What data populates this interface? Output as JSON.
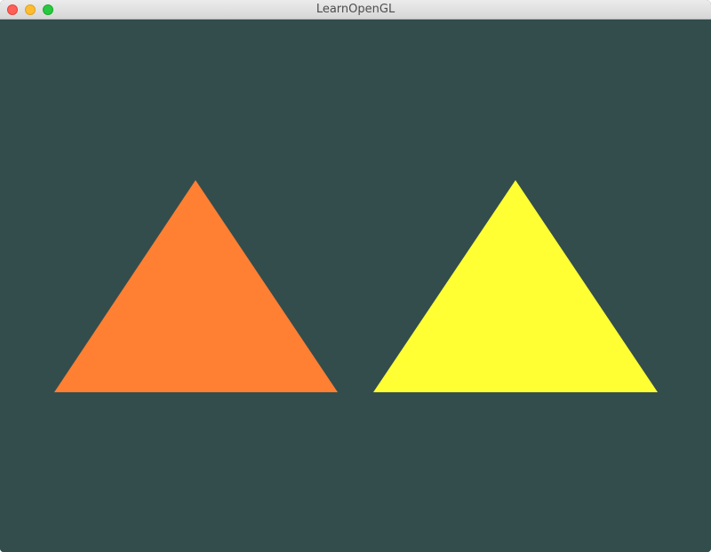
{
  "window": {
    "title": "LearnOpenGL"
  },
  "viewport": {
    "clear_color": "#334d4d",
    "triangles": [
      {
        "name": "orange",
        "color": "#ff7f33"
      },
      {
        "name": "yellow",
        "color": "#ffff33"
      }
    ]
  },
  "icons": {
    "close": "close-icon",
    "minimize": "minimize-icon",
    "maximize": "maximize-icon"
  }
}
